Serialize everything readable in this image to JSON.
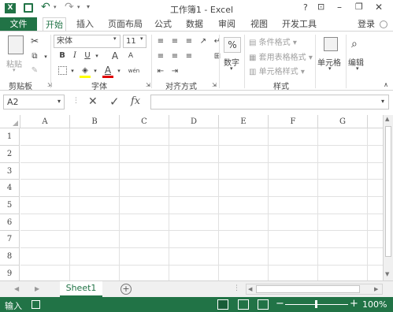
{
  "title": "工作簿1 - Excel",
  "quick_access": {
    "undo": "↶",
    "redo": "↷"
  },
  "window_controls": {
    "help": "?",
    "ribbon_options": "⊡",
    "minimize": "–",
    "restore": "❐",
    "close": "✕"
  },
  "tabs": [
    "文件",
    "开始",
    "插入",
    "页面布局",
    "公式",
    "数据",
    "审阅",
    "视图",
    "开发工具"
  ],
  "login": "登录",
  "ribbon": {
    "clipboard": {
      "label": "剪贴板",
      "paste": "粘贴"
    },
    "font": {
      "label": "字体",
      "name": "宋体",
      "size": "11",
      "bold": "B",
      "italic": "I",
      "underline": "U",
      "grow": "A",
      "shrink": "A",
      "color": "A",
      "phonetic": "wén"
    },
    "alignment": {
      "label": "对齐方式"
    },
    "number": {
      "label": "数字",
      "button": "数字",
      "icon": "%"
    },
    "styles": {
      "label": "样式",
      "conditional": "条件格式",
      "table": "套用表格格式",
      "cell": "单元格样式"
    },
    "cells": {
      "button": "单元格"
    },
    "editing": {
      "button": "编辑"
    }
  },
  "formula_bar": {
    "name_box": "A2",
    "fx": "fx",
    "cancel": "✕",
    "enter": "✓",
    "value": ""
  },
  "columns": [
    "A",
    "B",
    "C",
    "D",
    "E",
    "F",
    "G"
  ],
  "rows": [
    "1",
    "2",
    "3",
    "4",
    "5",
    "6",
    "7",
    "8",
    "9"
  ],
  "sheet_tab": "Sheet1",
  "add_sheet": "+",
  "status": {
    "mode": "输入",
    "zoom": "100%",
    "zoom_minus": "−",
    "zoom_plus": "+"
  },
  "colors": {
    "accent": "#217346",
    "font_red": "#e00000",
    "highlight": "#ffff00"
  }
}
